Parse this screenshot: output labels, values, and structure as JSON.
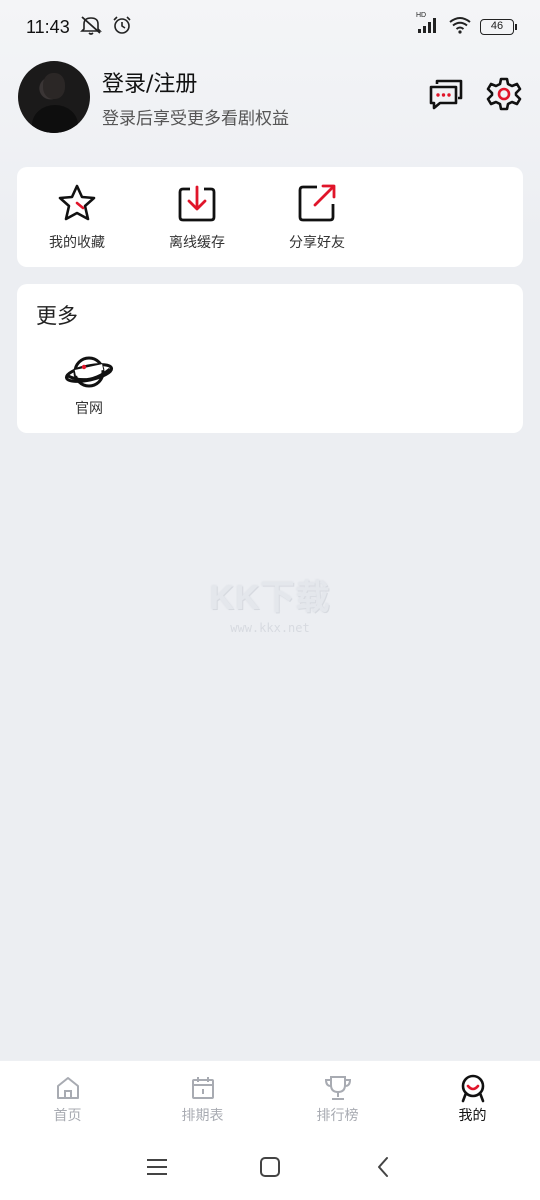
{
  "status_bar": {
    "time": "11:43",
    "battery": "46",
    "network_label": "HD"
  },
  "profile": {
    "title": "登录/注册",
    "subtitle": "登录后享受更多看剧权益"
  },
  "header_actions": [
    {
      "name": "message-icon"
    },
    {
      "name": "gear-icon"
    }
  ],
  "quick_actions": [
    {
      "label": "我的收藏",
      "icon": "star-icon"
    },
    {
      "label": "离线缓存",
      "icon": "download-icon"
    },
    {
      "label": "分享好友",
      "icon": "share-icon"
    }
  ],
  "more": {
    "title": "更多",
    "items": [
      {
        "label": "官网",
        "icon": "planet-icon"
      }
    ]
  },
  "watermark": {
    "main": "KK下载",
    "sub": "www.kkx.net"
  },
  "bottom_nav": [
    {
      "label": "首页",
      "icon": "home-icon",
      "active": false
    },
    {
      "label": "排期表",
      "icon": "calendar-icon",
      "active": false
    },
    {
      "label": "排行榜",
      "icon": "trophy-icon",
      "active": false
    },
    {
      "label": "我的",
      "icon": "profile-icon",
      "active": true
    }
  ],
  "colors": {
    "accent": "#e0152a",
    "background": "#eceef2",
    "nav_inactive": "#a8abb2"
  }
}
